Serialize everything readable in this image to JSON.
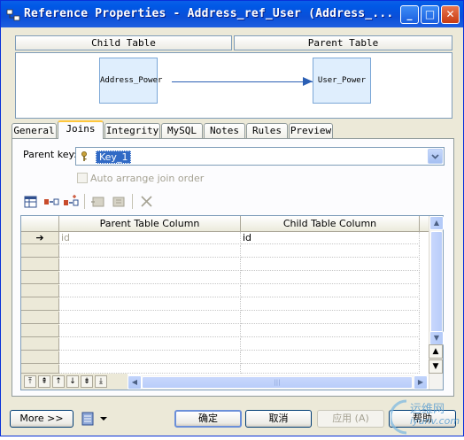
{
  "window": {
    "title": "Reference Properties - Address_ref_User (Address_...",
    "minimize_glyph": "_",
    "maximize_glyph": "□",
    "close_glyph": "✕"
  },
  "tables": {
    "child_header": "Child Table",
    "parent_header": "Parent Table",
    "child_entity": "Address_Power",
    "parent_entity": "User_Power"
  },
  "tabs": [
    {
      "label": "General"
    },
    {
      "label": "Joins"
    },
    {
      "label": "Integrity"
    },
    {
      "label": "MySQL"
    },
    {
      "label": "Notes"
    },
    {
      "label": "Rules"
    },
    {
      "label": "Preview"
    }
  ],
  "active_tab": "Joins",
  "joins": {
    "parent_key_label": "Parent key:",
    "parent_key_value": "Key_1",
    "auto_arrange_label": "Auto arrange join order",
    "auto_arrange_checked": false
  },
  "grid": {
    "columns": [
      "Parent Table Column",
      "Child Table Column"
    ],
    "rows": [
      {
        "marker": "➔",
        "parent": "id",
        "child": "id"
      }
    ],
    "row_count_visible": 11
  },
  "footer": {
    "more_label": "More >>",
    "ok_label": "确定",
    "cancel_label": "取消",
    "apply_label": "应用 (A)",
    "help_label": "帮助"
  },
  "watermark": {
    "text_top": "运维网",
    "text_bottom": "iyunv.com"
  },
  "colors": {
    "title_bar": "#0058e6",
    "selection": "#316ac5",
    "entity_fill": "#dfeefd",
    "link": "#2b5fb4",
    "active_tab_accent": "#ffc73c"
  }
}
